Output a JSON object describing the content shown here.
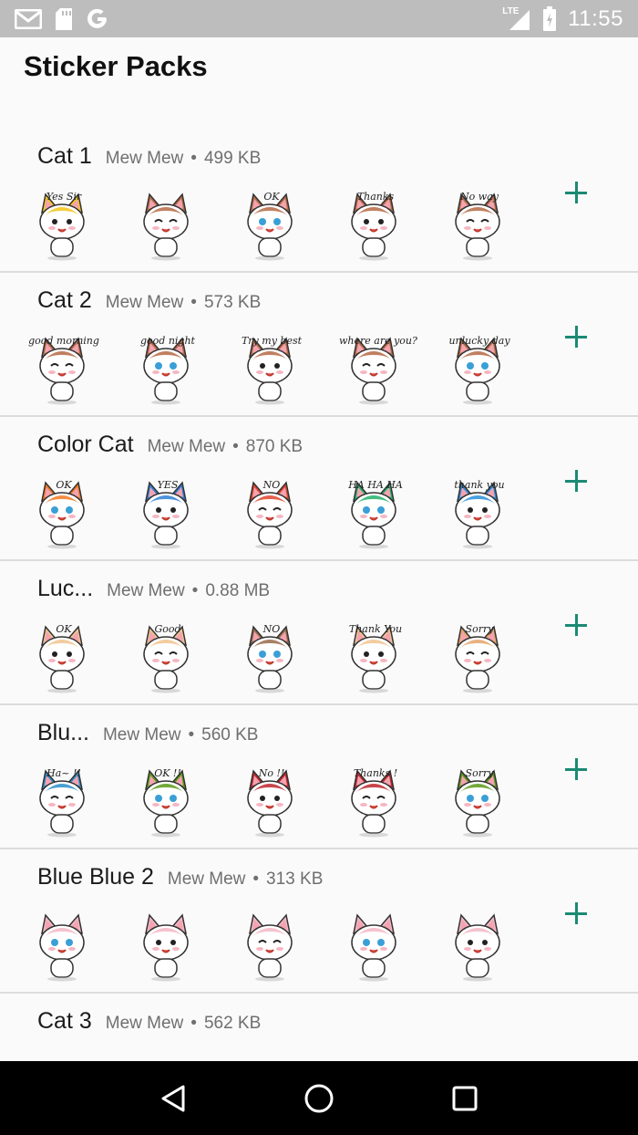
{
  "status_bar": {
    "time": "11:55",
    "network_label": "LTE",
    "icons": [
      "gmail-icon",
      "sd-card-icon",
      "google-icon",
      "lte-signal-icon",
      "battery-icon"
    ]
  },
  "app": {
    "title": "Sticker Packs",
    "accent_color": "#1b8a74"
  },
  "packs": [
    {
      "name": "Cat 1",
      "publisher": "Mew Mew",
      "separator": "•",
      "size": "499 KB",
      "stickers": [
        {
          "caption": "Yes Sir",
          "color": "#f5c518"
        },
        {
          "caption": "",
          "color": "#b56a45"
        },
        {
          "caption": "OK",
          "color": "#b56a45"
        },
        {
          "caption": "Thanks",
          "color": "#b56a45"
        },
        {
          "caption": "No way",
          "color": "#b56a45"
        }
      ]
    },
    {
      "name": "Cat 2",
      "publisher": "Mew Mew",
      "separator": "•",
      "size": "573 KB",
      "stickers": [
        {
          "caption": "good morning",
          "color": "#b56a45"
        },
        {
          "caption": "good night",
          "color": "#b56a45"
        },
        {
          "caption": "Try my best",
          "color": "#b56a45"
        },
        {
          "caption": "where are you?",
          "color": "#b56a45"
        },
        {
          "caption": "unlucky day",
          "color": "#b56a45"
        }
      ]
    },
    {
      "name": "Color Cat",
      "publisher": "Mew Mew",
      "separator": "•",
      "size": "870 KB",
      "stickers": [
        {
          "caption": "OK",
          "color": "#f07a26"
        },
        {
          "caption": "YES",
          "color": "#2f7fd6"
        },
        {
          "caption": "NO",
          "color": "#e0442b"
        },
        {
          "caption": "HA HA HA",
          "color": "#23b06b"
        },
        {
          "caption": "thank you",
          "color": "#2b8fd9"
        }
      ]
    },
    {
      "name": "Luc...",
      "publisher": "Mew Mew",
      "separator": "•",
      "size": "0.88 MB",
      "stickers": [
        {
          "caption": "OK",
          "color": "#f0c490"
        },
        {
          "caption": "Good",
          "color": "#f0c490"
        },
        {
          "caption": "NO",
          "color": "#9a6b4a"
        },
        {
          "caption": "Thank You",
          "color": "#f0c490"
        },
        {
          "caption": "Sorry",
          "color": "#e4a66a"
        }
      ]
    },
    {
      "name": "Blu...",
      "publisher": "Mew Mew",
      "separator": "•",
      "size": "560 KB",
      "stickers": [
        {
          "caption": "Ha~ !!",
          "color": "#2a8fc8"
        },
        {
          "caption": "OK !!",
          "color": "#5a9a1a"
        },
        {
          "caption": "No !!",
          "color": "#c0262d"
        },
        {
          "caption": "Thanks !",
          "color": "#c0262d"
        },
        {
          "caption": "Sorry",
          "color": "#5a9a1a"
        }
      ]
    },
    {
      "name": "Blue Blue 2",
      "publisher": "Mew Mew",
      "separator": "•",
      "size": "313 KB",
      "stickers": [
        {
          "caption": "",
          "color": "#f3b9c6"
        },
        {
          "caption": "",
          "color": "#f3b9c6"
        },
        {
          "caption": "",
          "color": "#f3b9c6"
        },
        {
          "caption": "",
          "color": "#f3b9c6"
        },
        {
          "caption": "",
          "color": "#f3b9c6"
        }
      ]
    },
    {
      "name": "Cat 3",
      "publisher": "Mew Mew",
      "separator": "•",
      "size": "562 KB",
      "stickers": []
    }
  ],
  "nav_bar": {
    "buttons": [
      "back-icon",
      "home-icon",
      "recents-icon"
    ]
  }
}
